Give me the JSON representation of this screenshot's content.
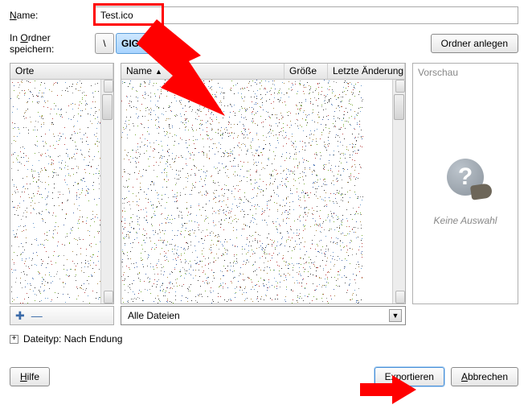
{
  "labels": {
    "name": "Name:",
    "save_in": "In Ordner speichern:",
    "create_folder": "Ordner anlegen",
    "places": "Orte",
    "file_name": "Name",
    "file_size": "Größe",
    "file_mtime": "Letzte Änderung",
    "preview_title": "Vorschau",
    "preview_empty": "Keine Auswahl",
    "filter": "Alle Dateien",
    "filetype": "Dateityp: Nach Endung",
    "help": "Hilfe",
    "export": "Exportieren",
    "cancel": "Abbrechen"
  },
  "fields": {
    "filename": "Test.ico"
  },
  "path": {
    "sep": "\\",
    "current": "GIGA"
  },
  "icons": {
    "plus": "✚",
    "minus": "—",
    "expand": "+",
    "sort_asc": "▲",
    "dropdown": "▼",
    "question": "?"
  }
}
